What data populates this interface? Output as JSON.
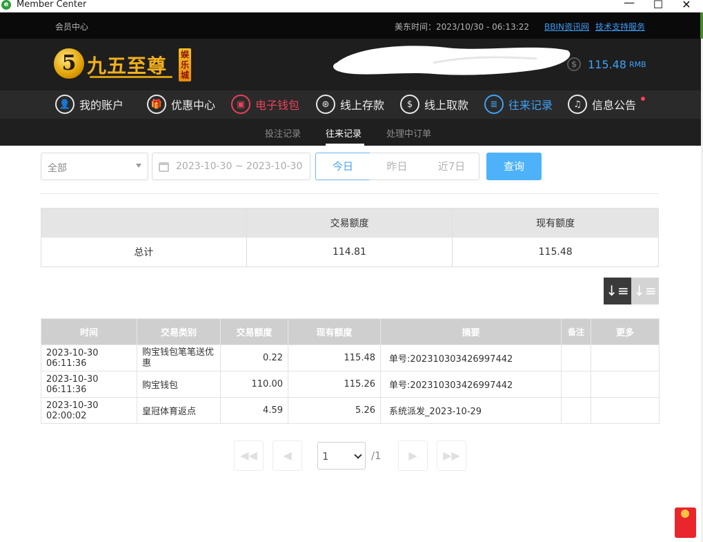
{
  "window": {
    "title": "Member Center",
    "app_icon": "e"
  },
  "topbar": {
    "member_center": "会员中心",
    "eastern_time": "美东时间：2023/10/30 - 06:13:22",
    "bbin_link": "BBIN资讯网",
    "support_link": "技术支持服务"
  },
  "brand": {
    "logo_numeral": "5",
    "logo_text": "九五至尊",
    "logo_tag": "娱乐城"
  },
  "balance": {
    "amount": "115.48",
    "unit": "RMB",
    "icon": "coin-icon"
  },
  "nav": [
    {
      "label": "我的账户",
      "icon": "user-icon",
      "glyph": "👤"
    },
    {
      "label": "优惠中心",
      "icon": "gift-icon",
      "glyph": "🎁"
    },
    {
      "label": "电子钱包",
      "icon": "wallet-icon",
      "glyph": "▣"
    },
    {
      "label": "线上存款",
      "icon": "deposit-icon",
      "glyph": "⊛"
    },
    {
      "label": "线上取款",
      "icon": "withdraw-icon",
      "glyph": "$"
    },
    {
      "label": "往来记录",
      "icon": "records-icon",
      "glyph": "≣"
    },
    {
      "label": "信息公告",
      "icon": "bell-icon",
      "glyph": "♫"
    }
  ],
  "subnav": {
    "bet_records": "投注记录",
    "transactions": "往来记录",
    "pending_orders": "处理中订单"
  },
  "filters": {
    "type_select": "全部",
    "date_range": "2023-10-30 ~ 2023-10-30",
    "today": "今日",
    "yesterday": "昨日",
    "last7": "近7日",
    "search": "查询"
  },
  "summary": {
    "headers": [
      "",
      "交易额度",
      "现有额度"
    ],
    "label": "总计",
    "trade_amount": "114.81",
    "current_amount": "115.48"
  },
  "records": {
    "headers": [
      "时间",
      "交易类别",
      "交易额度",
      "现有额度",
      "摘要",
      "备注",
      "更多"
    ],
    "rows": [
      [
        "2023-10-30 06:11:36",
        "购宝钱包笔笔送优惠",
        "0.22",
        "115.48",
        "单号:202310303426997442",
        "",
        ""
      ],
      [
        "2023-10-30 06:11:36",
        "购宝钱包",
        "110.00",
        "115.26",
        "单号:202310303426997442",
        "",
        ""
      ],
      [
        "2023-10-30 02:00:02",
        "皇冠体育返点",
        "4.59",
        "5.26",
        "系统派发_2023-10-29",
        "",
        ""
      ]
    ]
  },
  "pagination": {
    "page": "1",
    "total": "/1"
  },
  "colors": {
    "accent_blue": "#3fa2f7",
    "accent_red": "#e8425a",
    "gold": "#f3b01c"
  }
}
